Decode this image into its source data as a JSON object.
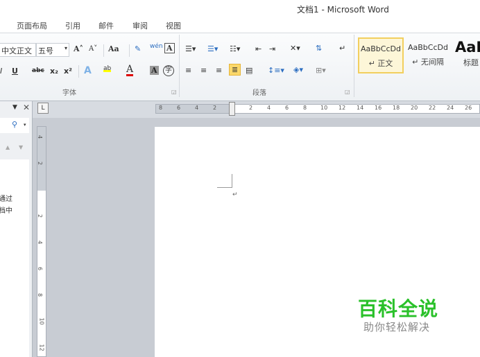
{
  "window": {
    "title": "文档1 - Microsoft Word"
  },
  "tabs": [
    "页面布局",
    "引用",
    "邮件",
    "审阅",
    "视图"
  ],
  "font_group": {
    "font_name": "中文正文",
    "font_size": "五号",
    "grow": "A˄",
    "shrink": "A˅",
    "change_case": "Aa",
    "phonetic": "wén",
    "char_border": "A",
    "underline": "U",
    "strike": "abc",
    "subscript": "x₂",
    "superscript": "x²",
    "text_effect": "A",
    "highlight": "ab",
    "font_color": "A",
    "char_shading": "A",
    "enclose": "字",
    "label": "字体"
  },
  "paragraph_group": {
    "label": "段落"
  },
  "styles": [
    {
      "preview": "AaBbCcDd",
      "name": "正文"
    },
    {
      "preview": "AaBbCcDd",
      "name": "无间隔"
    },
    {
      "preview": "AaB",
      "name": "标题"
    }
  ],
  "nav_pane": {
    "text_lines": [
      "通过",
      "档中"
    ]
  },
  "hruler": [
    "8",
    "6",
    "4",
    "2",
    "2",
    "4",
    "6",
    "8",
    "10",
    "12",
    "14",
    "16",
    "18",
    "20",
    "22",
    "24",
    "26"
  ],
  "vruler": [
    "4",
    "2",
    "2",
    "4",
    "6",
    "8",
    "10",
    "12"
  ],
  "watermark": {
    "title": "百科全说",
    "subtitle": "助你轻松解决"
  }
}
